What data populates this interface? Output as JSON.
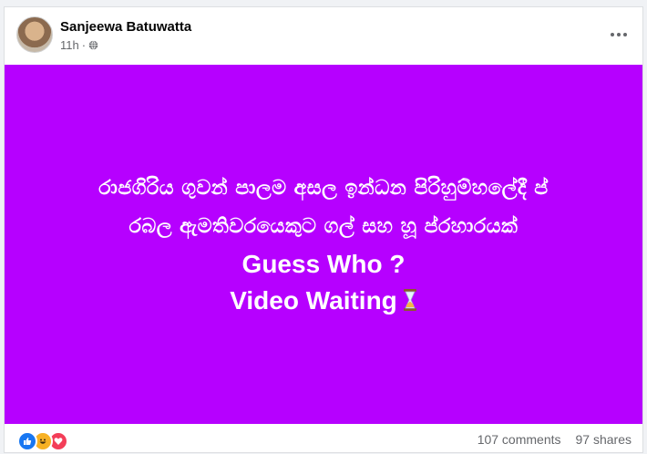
{
  "post": {
    "author": "Sanjeewa Batuwatta",
    "time": "11h",
    "dot": "·",
    "audience_icon": "globe-icon",
    "more_icon": "more-horizontal-icon",
    "content": {
      "background": "#b600ff",
      "line1": "රාජගිරිය ගුවන් පාලම අසල ඉන්ධන පිරිහුම්හලේදී ප්",
      "line2": "රබල ඇමතිවරයෙකුට ගල් සහ හූ ප්රහාරයක්",
      "line3": "Guess Who ?",
      "line4": "Video Waiting",
      "line4_icon": "hourglass-icon"
    },
    "footer": {
      "reactions": [
        "like-icon",
        "haha-icon",
        "love-icon"
      ],
      "comments": "107 comments",
      "shares": "97 shares"
    }
  }
}
